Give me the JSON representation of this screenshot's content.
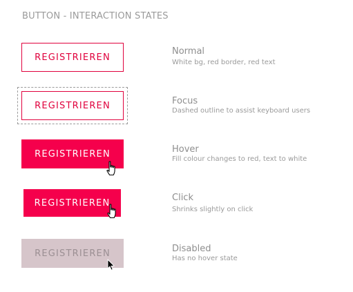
{
  "title": "BUTTON - INTERACTION STATES",
  "states": [
    {
      "button_label": "REGISTRIEREN",
      "state_name": "Normal",
      "description": "White bg, red border, red text"
    },
    {
      "button_label": "REGISTRIEREN",
      "state_name": "Focus",
      "description": "Dashed outline to assist keyboard users"
    },
    {
      "button_label": "REGISTRIEREN",
      "state_name": "Hover",
      "description": "Fill colour changes to red, text to white"
    },
    {
      "button_label": "REGISTRIEREN",
      "state_name": "Click",
      "description": "Shrinks slightly on click"
    },
    {
      "button_label": "REGISTRIEREN",
      "state_name": "Disabled",
      "description": "Has no hover state"
    }
  ],
  "colors": {
    "brand_red": "#e0003c",
    "fill_red": "#f5004c",
    "disabled_bg": "#d6c5ca",
    "disabled_text": "#9b8f93"
  },
  "icons": {
    "hover_cursor": "hand-pointer-icon",
    "click_cursor": "hand-pointer-icon",
    "disabled_cursor": "arrow-pointer-icon"
  }
}
